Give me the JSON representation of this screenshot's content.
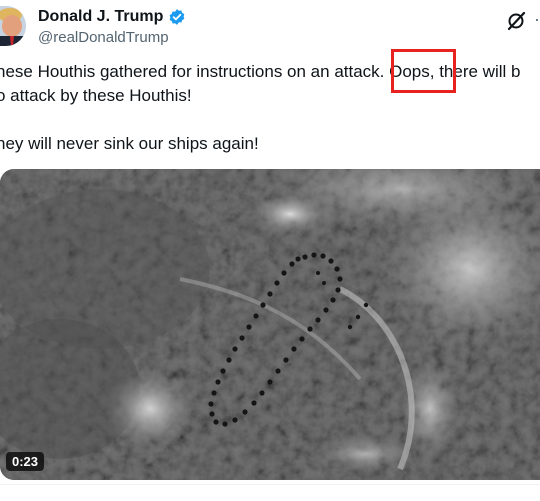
{
  "post": {
    "author_name": "Donald J. Trump",
    "author_handle": "@realDonaldTrump",
    "text_line1_before": "hese Houthis gathered for instructions on an attack",
    "text_line1_oops": ". Oops,",
    "text_line1_after": " there will b",
    "text_line2": "o attack by these Houthis!",
    "text_line3": "hey will never sink our ships again!",
    "media_duration": "0:23",
    "more_menu": "···"
  },
  "icons": {
    "verified": "verified-badge-icon",
    "grok": "grok-icon",
    "more": "more-options-icon"
  },
  "colors": {
    "highlight_box": "#e8231f",
    "verified": "#1d9bf0",
    "handle": "#536471"
  }
}
